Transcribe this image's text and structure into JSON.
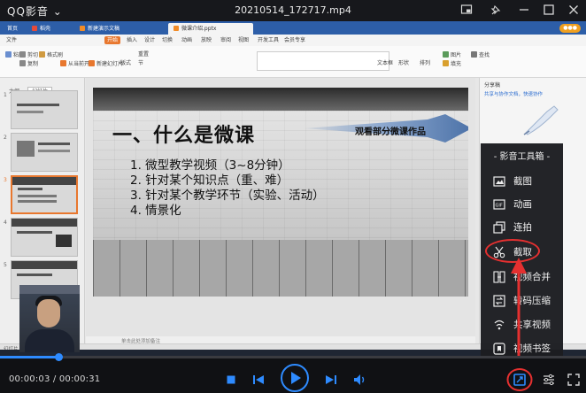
{
  "player": {
    "app_name": "QQ影音",
    "file_title": "20210514_172717.mp4",
    "current_time": "00:00:03",
    "duration": "00:00:31",
    "time_separator": " / ",
    "progress_fraction": 0.1,
    "accent_color": "#2e8bff"
  },
  "wps": {
    "doc_tabs": [
      {
        "label": "首页",
        "active": false
      },
      {
        "label": "稻壳",
        "active": false
      },
      {
        "label": "新建演示文稿",
        "active": false
      },
      {
        "label": "微课介绍.pptx",
        "active": true
      }
    ],
    "menu": [
      "文件",
      "开始",
      "插入",
      "设计",
      "切换",
      "动画",
      "放映",
      "审阅",
      "视图",
      "开发工具",
      "会员专享"
    ],
    "menu_active": "开始",
    "ribbon": {
      "paste": "粘贴",
      "cut": "剪切",
      "copy": "复制",
      "format_painter": "格式刷",
      "from_current": "从当前开始",
      "new_slide": "新建幻灯片",
      "layout": "版式",
      "section": "节",
      "reset": "重置",
      "textbox": "文本框",
      "shape": "形状",
      "arrange": "排列",
      "picture": "图片",
      "fill": "填充",
      "find": "查找"
    },
    "left_pane_tabs": [
      "大纲",
      "幻灯片"
    ],
    "notes_placeholder": "单击此处添加备注",
    "status_text": "幻灯片 3 / 18",
    "task_pane": {
      "title": "分享稿",
      "link": "共享与协作文档，快速协作"
    }
  },
  "slide": {
    "title": "一、什么是微课",
    "banner": "观看部分微课作品",
    "bullets": [
      "1. 微型教学视频（3~8分钟）",
      "2. 针对某个知识点（重、难）",
      "3. 针对某个教学环节（实验、活动）",
      "4. 情景化"
    ]
  },
  "toolbox": {
    "title": "- 影音工具箱 -",
    "items": [
      {
        "label": "截图",
        "icon": "screenshot-icon"
      },
      {
        "label": "动画",
        "icon": "gif-icon"
      },
      {
        "label": "连拍",
        "icon": "burst-shot-icon"
      },
      {
        "label": "截取",
        "icon": "scissors-icon"
      },
      {
        "label": "视频合并",
        "icon": "merge-video-icon"
      },
      {
        "label": "转码压缩",
        "icon": "transcode-icon"
      },
      {
        "label": "共享视频",
        "icon": "share-video-icon"
      },
      {
        "label": "视频书签",
        "icon": "bookmark-icon"
      }
    ]
  },
  "colors": {
    "annotation": "#e53030",
    "wps_blue": "#2d5ea8",
    "wps_orange": "#e8772e"
  }
}
